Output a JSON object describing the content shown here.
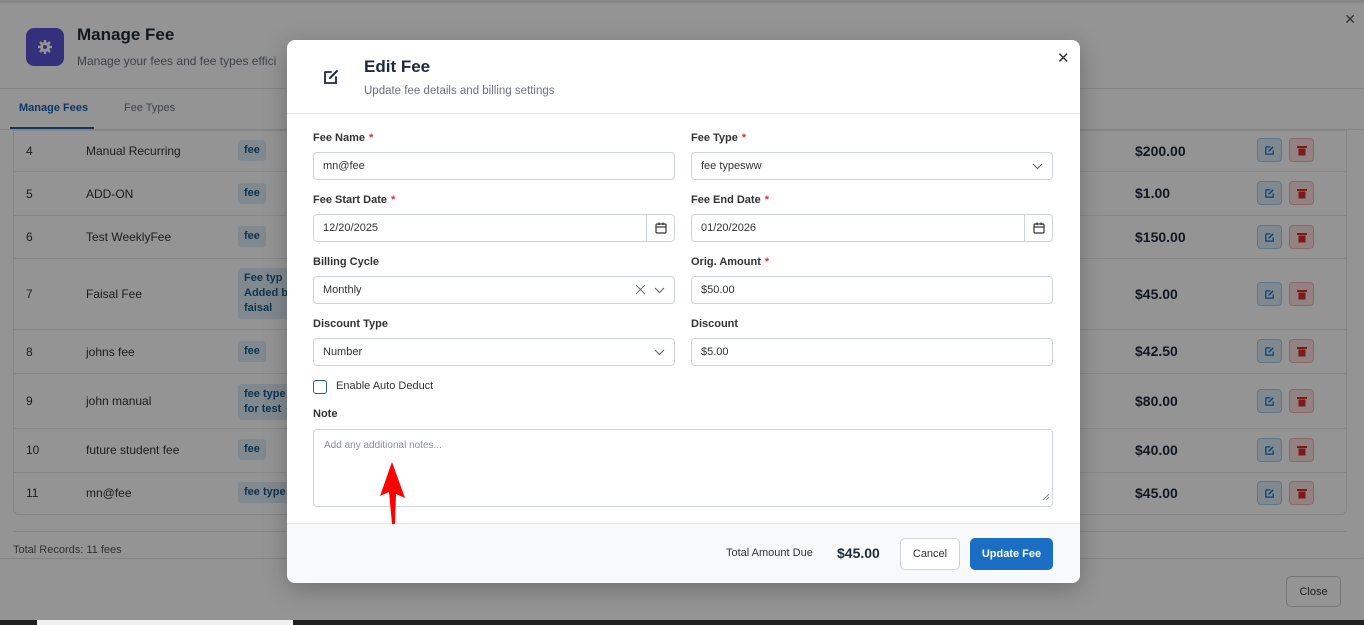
{
  "background": {
    "title": "Manage Fee",
    "subtitle": "Manage your fees and fee types effici",
    "tabs": [
      {
        "label": "Manage Fees",
        "active": true
      },
      {
        "label": "Fee Types",
        "active": false
      }
    ],
    "rows": [
      {
        "num": "4",
        "name": "Manual Recurring",
        "type": "fee",
        "amount": "$200.00"
      },
      {
        "num": "5",
        "name": "ADD-ON",
        "type": "fee",
        "amount": "$1.00"
      },
      {
        "num": "6",
        "name": "Test WeeklyFee",
        "type": "fee",
        "amount": "$150.00"
      },
      {
        "num": "7",
        "name": "Faisal Fee",
        "type": "Fee typ\nAdded b\nfaisal",
        "amount": "$45.00"
      },
      {
        "num": "8",
        "name": "johns fee",
        "type": "fee",
        "amount": "$42.50"
      },
      {
        "num": "9",
        "name": "john manual",
        "type": "fee type\nfor test",
        "amount": "$80.00"
      },
      {
        "num": "10",
        "name": "future student fee",
        "type": "fee",
        "amount": "$40.00"
      },
      {
        "num": "11",
        "name": "mn@fee",
        "type": "fee type",
        "amount": "$45.00"
      }
    ],
    "total_records": "Total Records: 11 fees",
    "close_label": "Close"
  },
  "modal": {
    "title": "Edit Fee",
    "subtitle": "Update fee details and billing settings",
    "fee_name": {
      "label": "Fee Name",
      "value": "mn@fee"
    },
    "fee_type": {
      "label": "Fee Type",
      "value": "fee typesww"
    },
    "start_date": {
      "label": "Fee Start Date",
      "value": "12/20/2025"
    },
    "end_date": {
      "label": "Fee End Date",
      "value": "01/20/2026"
    },
    "billing_cycle": {
      "label": "Billing Cycle",
      "value": "Monthly"
    },
    "orig_amount": {
      "label": "Orig. Amount",
      "value": "$50.00"
    },
    "discount_type": {
      "label": "Discount Type",
      "value": "Number"
    },
    "discount": {
      "label": "Discount",
      "value": "$5.00"
    },
    "auto_deduct": {
      "label": "Enable Auto Deduct",
      "checked": false
    },
    "note": {
      "label": "Note",
      "placeholder": "Add any additional notes..."
    },
    "required_mark": "*",
    "total_label": "Total Amount Due",
    "total_value": "$45.00",
    "cancel_label": "Cancel",
    "update_label": "Update Fee"
  },
  "colors": {
    "accent": "#1a6fc4",
    "brand": "#5b54d6",
    "danger": "#d32f2f",
    "arrow": "#ff0000"
  }
}
